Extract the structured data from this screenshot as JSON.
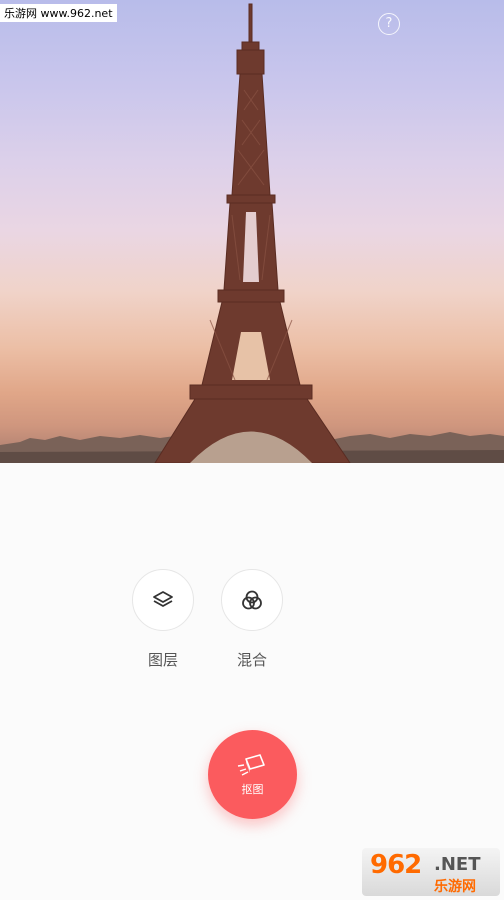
{
  "watermark": {
    "top": "乐游网 www.962.net"
  },
  "help": {
    "glyph": "?"
  },
  "tools": [
    {
      "label": "图层",
      "icon": "layers-icon"
    },
    {
      "label": "混合",
      "icon": "blend-icon"
    }
  ],
  "fab": {
    "label": "抠图",
    "icon": "eraser-icon",
    "color": "#fb5b5e"
  },
  "logo": {
    "big": "962",
    "net": ".NET",
    "cn": "乐游网"
  }
}
